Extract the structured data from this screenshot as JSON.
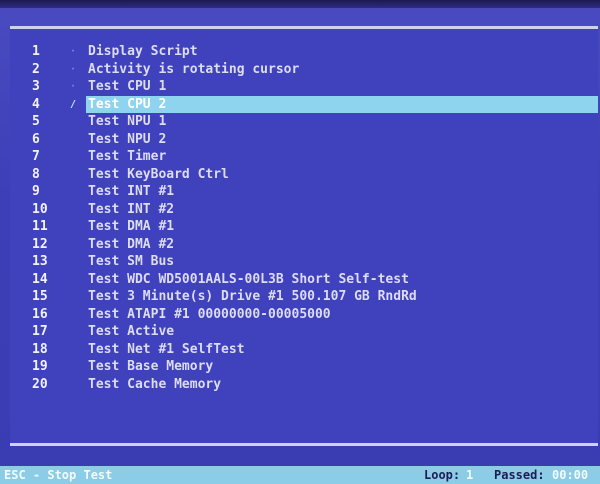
{
  "tests": [
    {
      "num": "1",
      "label": "Display Script",
      "mark": "·"
    },
    {
      "num": "2",
      "label": "Activity is rotating cursor",
      "mark": "·"
    },
    {
      "num": "3",
      "label": "Test CPU 1",
      "mark": "·"
    },
    {
      "num": "4",
      "label": "Test CPU 2",
      "mark": "/"
    },
    {
      "num": "5",
      "label": "Test NPU 1",
      "mark": ""
    },
    {
      "num": "6",
      "label": "Test NPU 2",
      "mark": ""
    },
    {
      "num": "7",
      "label": "Test Timer",
      "mark": ""
    },
    {
      "num": "8",
      "label": "Test KeyBoard Ctrl",
      "mark": ""
    },
    {
      "num": "9",
      "label": "Test INT #1",
      "mark": ""
    },
    {
      "num": "10",
      "label": "Test INT #2",
      "mark": ""
    },
    {
      "num": "11",
      "label": "Test DMA #1",
      "mark": ""
    },
    {
      "num": "12",
      "label": "Test DMA #2",
      "mark": ""
    },
    {
      "num": "13",
      "label": "Test SM Bus",
      "mark": ""
    },
    {
      "num": "14",
      "label": "Test WDC WD5001AALS-00L3B Short Self-test",
      "mark": ""
    },
    {
      "num": "15",
      "label": "Test 3 Minute(s) Drive #1 500.107 GB RndRd",
      "mark": ""
    },
    {
      "num": "16",
      "label": "Test ATAPI #1 00000000-00005000",
      "mark": ""
    },
    {
      "num": "17",
      "label": "Test Active",
      "mark": ""
    },
    {
      "num": "18",
      "label": "Test Net #1 SelfTest",
      "mark": ""
    },
    {
      "num": "19",
      "label": "Test Base Memory",
      "mark": ""
    },
    {
      "num": "20",
      "label": "Test Cache Memory",
      "mark": ""
    }
  ],
  "current_index": 3,
  "status_bar": {
    "stop_hint": "ESC - Stop Test",
    "loop_label": "Loop:",
    "loop_value": "1",
    "passed_label": "Passed:",
    "passed_value": "00:00"
  },
  "colors": {
    "background": "#3f41bd",
    "highlight": "#8fd4ee",
    "status_bar": "#8bcde6"
  }
}
